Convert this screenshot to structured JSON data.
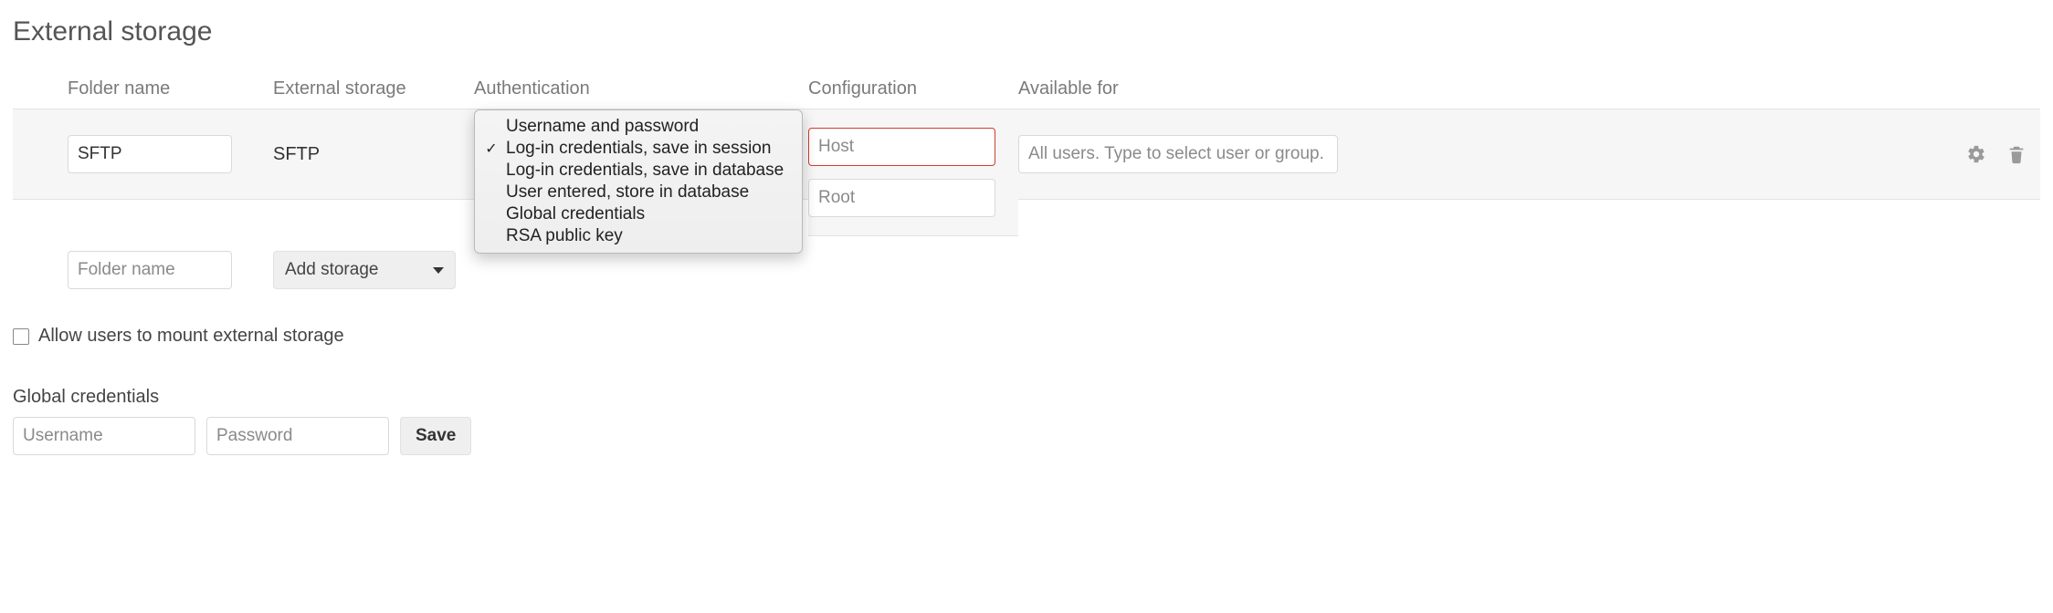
{
  "title": "External storage",
  "columns": {
    "folder": "Folder name",
    "storage": "External storage",
    "auth": "Authentication",
    "config": "Configuration",
    "available": "Available for"
  },
  "mount": {
    "folder_value": "SFTP",
    "storage_value": "SFTP",
    "auth_selected_index": 1,
    "auth_options": [
      "Username and password",
      "Log-in credentials, save in session",
      "Log-in credentials, save in database",
      "User entered, store in database",
      "Global credentials",
      "RSA public key"
    ],
    "config": {
      "host_value": "",
      "host_placeholder": "Host",
      "root_value": "",
      "root_placeholder": "Root"
    },
    "available_value": "",
    "available_placeholder": "All users. Type to select user or group."
  },
  "add_row": {
    "folder_placeholder": "Folder name",
    "folder_value": "",
    "storage_select_label": "Add storage"
  },
  "allow_user_mount": {
    "checked": false,
    "label": "Allow users to mount external storage"
  },
  "global_credentials": {
    "heading": "Global credentials",
    "username_placeholder": "Username",
    "username_value": "",
    "password_placeholder": "Password",
    "password_value": "",
    "save_label": "Save"
  },
  "icons": {
    "settings": "gear-icon",
    "delete": "trash-icon",
    "caret": "chevron-down-icon",
    "check": "check-icon"
  }
}
